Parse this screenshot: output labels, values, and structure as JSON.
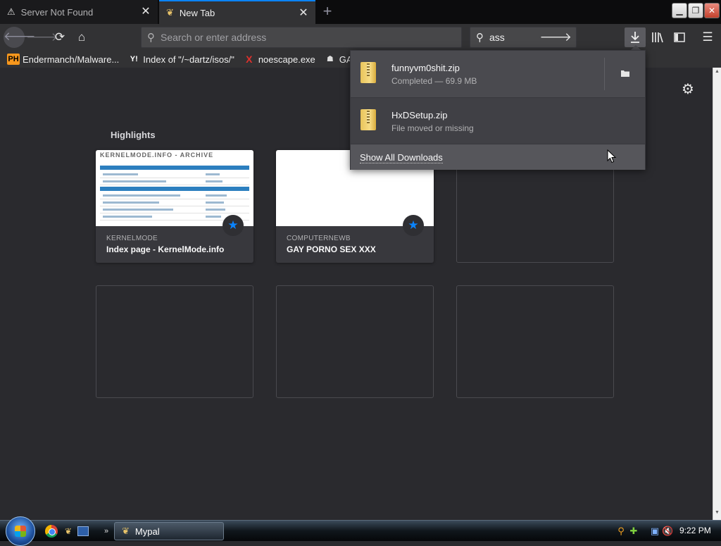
{
  "tabs": [
    {
      "label": "Server Not Found",
      "icon": "warning-icon",
      "active": false
    },
    {
      "label": "New Tab",
      "icon": "mypal-icon",
      "active": true
    }
  ],
  "window_buttons": {
    "minimize": "▁",
    "maximize": "❐",
    "close": "✕"
  },
  "urlbar": {
    "placeholder": "Search or enter address",
    "value": ""
  },
  "searchbar": {
    "value": "ass"
  },
  "bookmarks": [
    {
      "label": "Endermanch/Malware...",
      "badge": "PH",
      "badge_color": "#f7971d"
    },
    {
      "label": "Index of \"/~dartz/isos/\"",
      "badge": "Y!",
      "badge_color": "#ffffff"
    },
    {
      "label": "noescape.exe",
      "badge": "X",
      "badge_color": "#e0312d"
    },
    {
      "label": "GAY POR",
      "badge": "☗",
      "badge_color": "#dddddd"
    }
  ],
  "highlights": {
    "title": "Highlights",
    "cards": [
      {
        "host": "KERNELMODE",
        "title": "Index page - KernelMode.info",
        "thumb_head": "KERNELMODE.INFO - ARCHIVE"
      },
      {
        "host": "COMPUTERNEWB",
        "title": "GAY PORNO SEX XXX"
      }
    ]
  },
  "downloads": {
    "items": [
      {
        "name": "funnyvm0shit.zip",
        "status": "Completed — 69.9 MB"
      },
      {
        "name": "HxDSetup.zip",
        "status": "File moved or missing"
      }
    ],
    "show_all_label": "Show All Downloads"
  },
  "taskbar": {
    "task_label": "Mypal",
    "clock": "9:22 PM"
  },
  "colors": {
    "accent": "#0a84ff",
    "background": "#2a2a2e",
    "toolbar": "#323234"
  }
}
